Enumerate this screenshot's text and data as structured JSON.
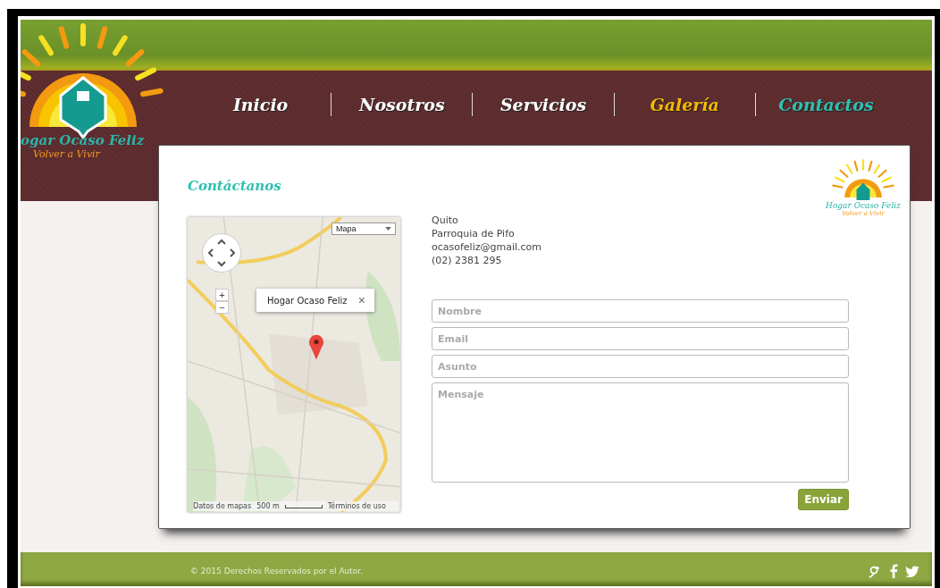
{
  "logo": {
    "title": "ogar Ocaso Feliz",
    "tagline": "Volver a Vivir"
  },
  "nav": [
    {
      "label": "Inicio",
      "color": "#ffffff"
    },
    {
      "label": "Nosotros",
      "color": "#ffffff"
    },
    {
      "label": "Servicios",
      "color": "#ffffff"
    },
    {
      "label": "Galería",
      "color": "#f5b800"
    },
    {
      "label": "Contactos",
      "color": "#2fc0b0"
    }
  ],
  "card": {
    "heading": "Contáctanos",
    "logo": {
      "title": "Hogar Ocaso Feliz",
      "tagline": "Volver a Vivir"
    }
  },
  "map": {
    "type_select": "Mapa",
    "zoom_in": "+",
    "zoom_out": "−",
    "popup": "Hogar Ocaso Feliz",
    "close": "×",
    "attribution": "Datos de mapas",
    "scale": "500 m",
    "terms": "Términos de uso"
  },
  "contact": [
    "Quito",
    "Parroquia de Pifo",
    "ocasofeliz@gmail.com",
    "(02) 2381 295"
  ],
  "form": {
    "fields": [
      {
        "kind": "input",
        "placeholder": "Nombre"
      },
      {
        "kind": "input",
        "placeholder": "Email"
      },
      {
        "kind": "input",
        "placeholder": "Asunto"
      },
      {
        "kind": "textarea",
        "placeholder": "Mensaje"
      }
    ],
    "submit": "Enviar"
  },
  "footer": {
    "copyright": "© 2015 Derechos Reservados por el Autor."
  }
}
